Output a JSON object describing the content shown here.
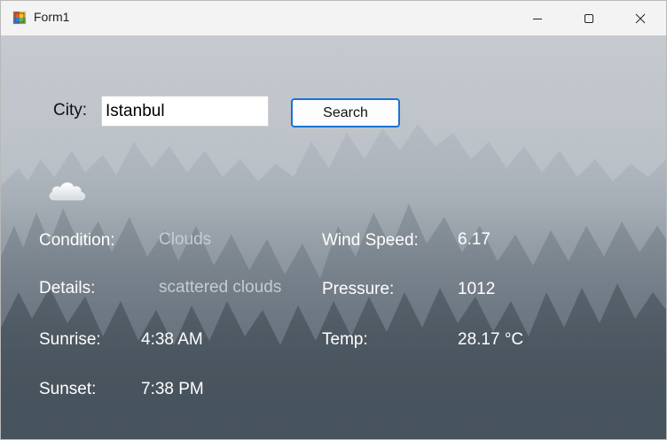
{
  "window": {
    "title": "Form1",
    "minimize_icon": "minimize-icon",
    "maximize_icon": "maximize-icon",
    "close_icon": "close-icon"
  },
  "search": {
    "city_label": "City:",
    "city_value": "Istanbul",
    "button_label": "Search"
  },
  "weather": {
    "icon": "cloud-icon",
    "condition_label": "Condition:",
    "condition_value": "Clouds",
    "details_label": "Details:",
    "details_value": "scattered clouds",
    "sunrise_label": "Sunrise:",
    "sunrise_value": "4:38 AM",
    "sunset_label": "Sunset:",
    "sunset_value": "7:38 PM",
    "wind_label": "Wind Speed:",
    "wind_value": "6.17",
    "pressure_label": "Pressure:",
    "pressure_value": "1012",
    "temp_label": "Temp:",
    "temp_value": "28.17 °C"
  },
  "colors": {
    "accent": "#1a73d1",
    "titlebar": "#f3f3f3",
    "label_text": "#ffffff",
    "dim_value_text": "#c6cbd0"
  }
}
